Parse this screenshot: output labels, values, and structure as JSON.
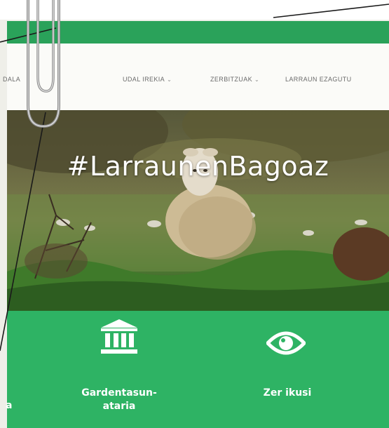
{
  "nav": {
    "logo_fragment": "DALA",
    "items": [
      {
        "label": "UDAL IREKIA",
        "has_dropdown": true
      },
      {
        "label": "ZERBITZUAK",
        "has_dropdown": true
      },
      {
        "label": "LARRAUN EZAGUTU",
        "has_dropdown": false
      }
    ]
  },
  "hero": {
    "title": "#LarraunenBagoaz"
  },
  "features": [
    {
      "label_fragment": "a"
    },
    {
      "icon": "building-columns-icon",
      "label_line1": "Gardentasun-",
      "label_line2": "ataria"
    },
    {
      "icon": "eye-icon",
      "label": "Zer ikusi"
    }
  ],
  "colors": {
    "brand_green": "#2aa25a",
    "band_green": "#2eb364",
    "nav_text": "#6a6a6a"
  }
}
